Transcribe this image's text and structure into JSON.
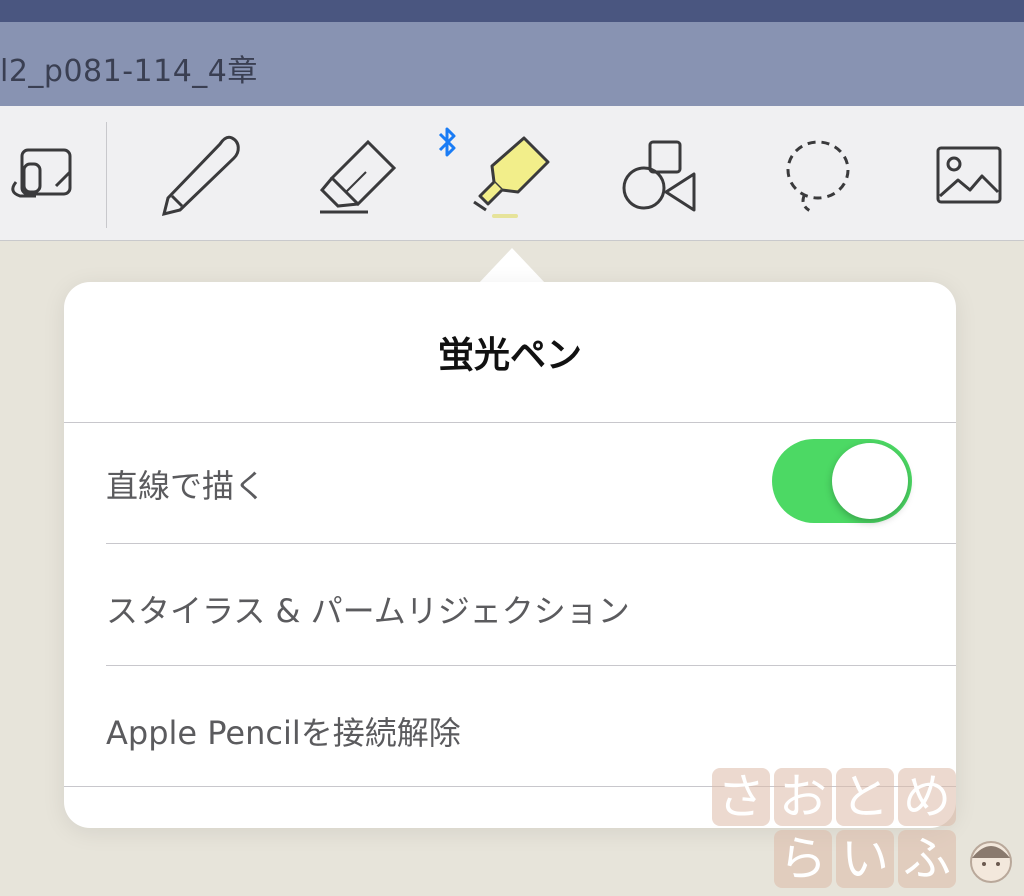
{
  "window": {
    "title": "l2_p081-114_4章"
  },
  "toolbar": {
    "tools": [
      {
        "name": "document-tool",
        "icon": "document-zoom-icon"
      },
      {
        "name": "pen-tool",
        "icon": "pen-icon"
      },
      {
        "name": "eraser-tool",
        "icon": "eraser-icon"
      },
      {
        "name": "highlighter-tool",
        "icon": "highlighter-icon",
        "selected": true
      },
      {
        "name": "shapes-tool",
        "icon": "shapes-icon"
      },
      {
        "name": "lasso-tool",
        "icon": "lasso-icon"
      },
      {
        "name": "image-tool",
        "icon": "image-icon"
      }
    ],
    "bluetooth_icon": "bluetooth-icon",
    "highlighter_color": "#f2ee8a"
  },
  "popover": {
    "title": "蛍光ペン",
    "rows": [
      {
        "label": "直線で描く",
        "toggle": true
      },
      {
        "label": "スタイラス & パームリジェクション"
      },
      {
        "label": "Apple Pencilを接続解除"
      }
    ]
  },
  "colors": {
    "toggle_on": "#4cd964",
    "bluetooth": "#1a7cf5",
    "titlebar": "#8893b2",
    "topbar": "#4a5680"
  },
  "watermark": {
    "chars": [
      "さ",
      "お",
      "と",
      "め",
      "ら",
      "い",
      "ふ"
    ]
  }
}
